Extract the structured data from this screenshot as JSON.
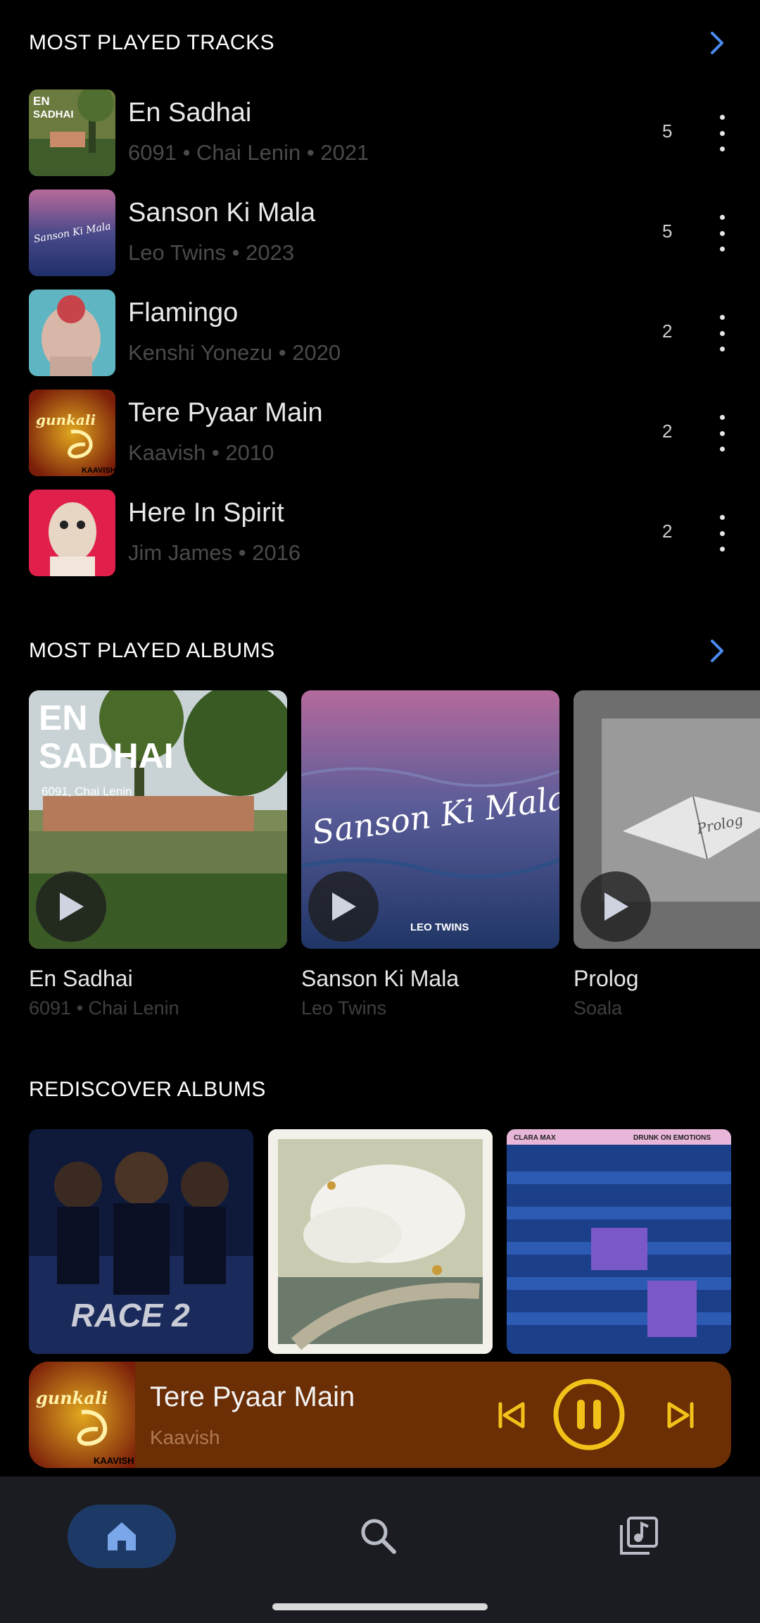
{
  "tracks_section": {
    "title": "MOST PLAYED TRACKS"
  },
  "tracks": [
    {
      "title": "En Sadhai",
      "subtitle": "6091 • Chai Lenin • 2021",
      "count": "5",
      "art_text": "EN SADHAI"
    },
    {
      "title": "Sanson Ki Mala",
      "subtitle": "Leo Twins • 2023",
      "count": "5",
      "art_text": "Sanson Ki Mala"
    },
    {
      "title": "Flamingo",
      "subtitle": "Kenshi Yonezu • 2020",
      "count": "2"
    },
    {
      "title": "Tere Pyaar Main",
      "subtitle": "Kaavish • 2010",
      "count": "2",
      "art_text": "gunkali"
    },
    {
      "title": "Here In Spirit",
      "subtitle": "Jim James • 2016",
      "count": "2"
    }
  ],
  "albums_section": {
    "title": "MOST PLAYED ALBUMS"
  },
  "albums": [
    {
      "title": "En Sadhai",
      "subtitle": "6091 • Chai Lenin",
      "art_line1": "EN",
      "art_line2": "SADHAI",
      "art_line3": "6091, Chai Lenin"
    },
    {
      "title": "Sanson Ki Mala",
      "subtitle": "Leo Twins",
      "art_line1": "Sanson Ki Mala",
      "art_line2": "LEO TWINS"
    },
    {
      "title": "Prolog",
      "subtitle": "Soala",
      "art_line1": "Prolog"
    }
  ],
  "rediscover_section": {
    "title": "REDISCOVER ALBUMS"
  },
  "rediscover": [
    {
      "art_text": "RACE 2"
    },
    {
      "art_text": ""
    },
    {
      "art_text_left": "CLARA MAX",
      "art_text_right": "DRUNK ON EMOTIONS"
    }
  ],
  "now_playing": {
    "title": "Tere Pyaar Main",
    "artist": "Kaavish",
    "art_text": "gunkali",
    "art_label": "KAAVISH"
  },
  "colors": {
    "accent": "#4a8cf0",
    "player_bg": "#6b2e05",
    "player_controls": "#f2c21b",
    "nav_bg": "#1b1c21",
    "home_pill": "#1d3a66"
  },
  "nav": {
    "items": [
      "home-icon",
      "search-icon",
      "library-icon"
    ],
    "active": "home"
  }
}
